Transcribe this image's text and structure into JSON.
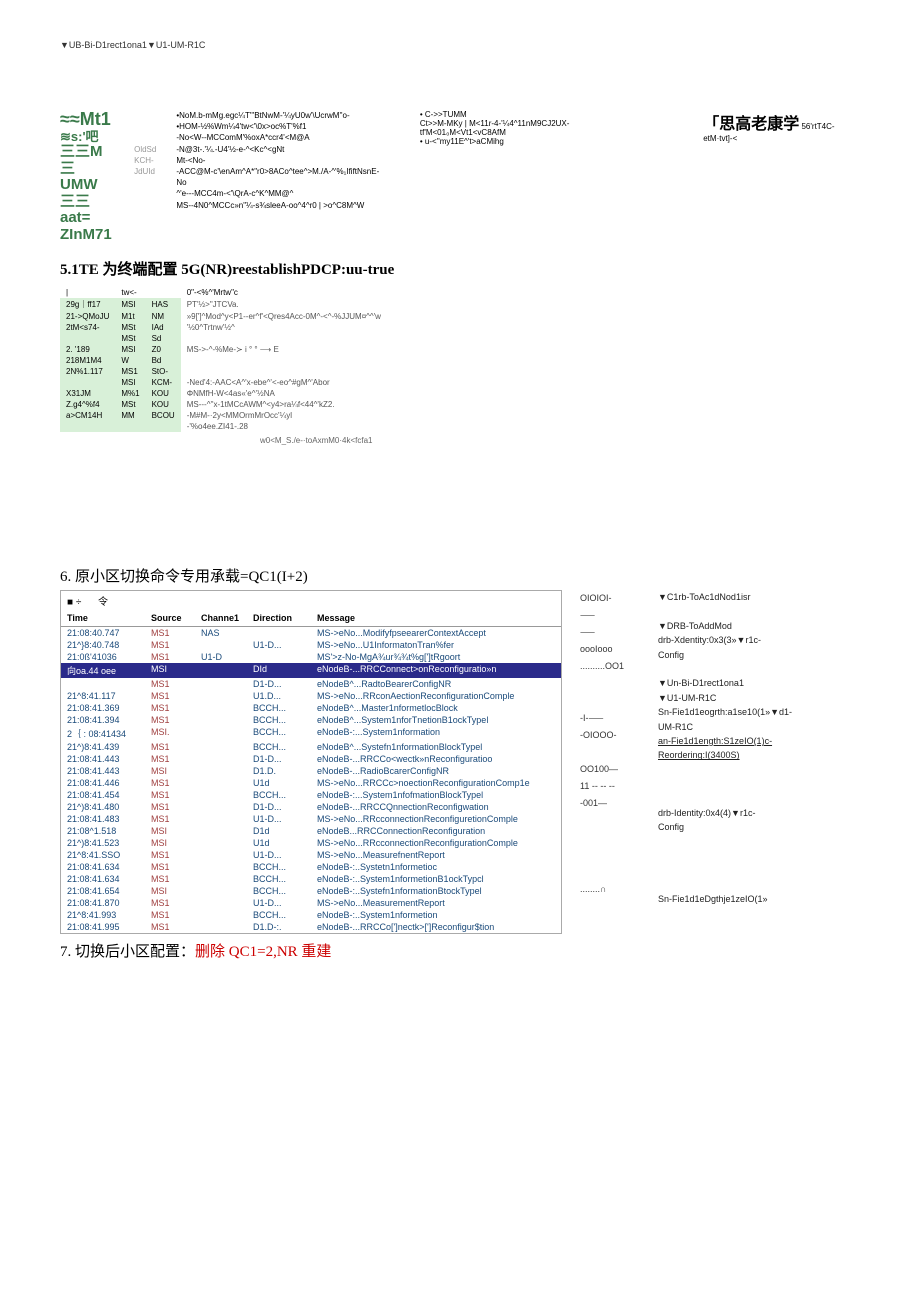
{
  "top_line": "▼UB-Bi-D1rect1ona1▼U1-UM-R1C",
  "blob1": {
    "l1": "≈≈Mt1",
    "l2": "≋s:'吧",
    "l3": "三三M",
    "l4": "三 UMW",
    "l5": "三三",
    "l6": "aat=",
    "l7": "ZInM71"
  },
  "midlabels": [
    "OldSd",
    "KCH-",
    "JdUId"
  ],
  "midlines": [
    "•NoM.b-mMg.egc¼T'\"BtNwM-'¼yU0w'\\UcrwM''o-",
    "•HOM-½%Wm¼4'tw<'\\0x>oc%T'%f1",
    "-No<W--MCComM'%oxA*ccr4'<M@A",
    "-N@3t-.'¼.-U4'½-e-^<Kc^<gNt",
    "Mt-<No-",
    "-ACC@M-c'\\enAm^A*\"r0>8ACo^tee^>M./A-^'%₁IfiftNsnE-No",
    "^'e---MCC4m-<'\\QrA-c^K^MM@^",
    "MS--4N0^MCCc»n\"¼-s¾sleeA-oo^4^r0  |  >o^C8M^W"
  ],
  "right1": [
    "• C->>TUMM",
    "Ct>>M-MKy  |  M<11r-4-'¼4^11nM9CJ2UX-tf'M<01₀M<Vt1<vC8AfM",
    "• u-<''my11E^'t>aCMihg"
  ],
  "cjk": "「思高老康学",
  "cjk_tail": "56'rtT4C-etM·tvt]-<",
  "h5": "5.1TE 为终端配置 5G(NR)reestablishPDCP:uu-true",
  "t5head": [
    "|",
    "tw<-",
    "0\"-<%^'Mrtw\"c"
  ],
  "t5": [
    [
      "29g｜ff17",
      "MSI",
      "HAS",
      "PT'½>\"JTCVa."
    ],
    [
      "21->QMoJU",
      "M1t",
      "NM",
      "»9[']^Mod^y<P1--er^f'<Qres4Acc-0M^-<^-%JJUM¤^^'w"
    ],
    [
      "2tM<s74-",
      "MSt",
      "IAd",
      "'½0^Trtnw'½^"
    ],
    [
      "",
      "MSt",
      "Sd",
      ""
    ],
    [
      "2.  '189",
      "MSI",
      "Z0",
      "MS->-^-%Me-≻    i   °      °   ⟶    E"
    ],
    [
      "218M1M4",
      "W",
      "Bd",
      ""
    ],
    [
      "2N%1.117",
      "MS1",
      "StO-",
      ""
    ],
    [
      "",
      "MSI",
      "KCM-",
      "-Ned'4:-AAC<A^'x-ebe^'<-eo^#gM^'Abor"
    ],
    [
      "X31JM",
      "M%1",
      "KOU",
      "ΦNMfH-W<4as«'e^'½NA"
    ],
    [
      "Z.g4^%f4",
      "MSt",
      "KOU",
      "MS---^''x-1tMCcAWM^<y4>ra¼f<44^'kZ2."
    ],
    [
      "a>CM14H",
      "MM",
      "BCOU",
      "-M#M-·2y<MMOrmMrOcc'¼yl"
    ],
    [
      "",
      "",
      "",
      "-'%o4ee.ZⅠ41-.28"
    ]
  ],
  "sub5": "w0<M_S./e-·toAxmM0·4k<fcfa1",
  "h6": "6. 原小区切换命令专用承载=QC1(I+2)",
  "t6cols": {
    "time": "Time",
    "src": "Source",
    "ch": "Channe1",
    "dir": "Direction",
    "msg": "Message"
  },
  "sq": "■ ÷",
  "sqr": "令",
  "t6": [
    [
      "21:08:40.747",
      "MS1",
      "NAS",
      "",
      "MS->eNo...ModifyfpseearerContextAccept",
      0
    ],
    [
      "21^}8:40.748",
      "MS1",
      "",
      "U1-D...",
      "MS->eNo...U1InformatonTran%fer",
      0
    ],
    [
      "21:0ß'41036",
      "MS1",
      "U1-D",
      "",
      "MS'>z-No-MgA¾ur¾¾t%g[']tRgoort",
      0
    ],
    [
      "向oa.44 oee",
      "MSI",
      "",
      "DId",
      "eNodeB-...RRCConnect>onReconfiguratio»n",
      1
    ],
    [
      "",
      "MS1",
      "",
      "D1-D...",
      "eNodeB^...RadtoBearerConfigNR",
      0
    ],
    [
      "21^8:41.117",
      "MS1",
      "",
      "U1.D...",
      "MS->eNo...RRconAectionReconfigurationComple",
      0
    ],
    [
      "21:08:41.369",
      "MS1",
      "",
      "BCCH...",
      "eNodeB^...Master1nformetlocBlock",
      0
    ],
    [
      "21:08:41.394",
      "MS1",
      "",
      "BCCH...",
      "eNodeB^...System1nforTnetionB1ockTypel",
      0
    ],
    [
      "2｛ :  08:41434",
      "MSI.",
      "",
      "BCCH...",
      "eNodeB-:...System1nformation",
      0
    ],
    [
      "21^)8:41.439",
      "MS1",
      "",
      "BCCH...",
      "eNodeB^...Systefn1nformationBlockTypel",
      0
    ],
    [
      "21:08:41.443",
      "MS1",
      "",
      "D1-D...",
      "eNodeB-...RRCCo<wectk»nReconfiguratioo",
      0
    ],
    [
      "21:08:41.443",
      "MSI",
      "",
      "D1.D.",
      "eNodeB-...RadioBcarerConfigNR",
      0
    ],
    [
      "21:08:41.446",
      "MS1",
      "",
      "U1d",
      "MS->eNo...RRCCc>noectionReconfigurationComp1e",
      0
    ],
    [
      "21:08:41.454",
      "MS1",
      "",
      "BCCH...",
      "eNodeB-:...System1nfofmationBlockTypel",
      0
    ],
    [
      "21^)8:41.480",
      "MS1",
      "",
      "D1-D...",
      "eNodeB-...RRCCQnnectionReconfigwation",
      0
    ],
    [
      "21:08:41.483",
      "MS1",
      "",
      "U1-D...",
      "MS->eNo...RRcconnectionReconfiguretionComple",
      0
    ],
    [
      "21:08^1.518",
      "MSI",
      "",
      "D1d",
      "eNodeB...RRCConnectionReconfiguration",
      0
    ],
    [
      "21^)8:41.523",
      "MSI",
      "",
      "U1d",
      "MS->eNo...RRcconnectionReconfigurationComple",
      0
    ],
    [
      "21^8:41.SSO",
      "MS1",
      "",
      "U1-D...",
      "MS->eNo...MeasurefnentReport",
      0
    ],
    [
      "21:08:41.634",
      "MS1",
      "",
      "BCCH...",
      "eNodeB-:..Systetn1nformetioc",
      0
    ],
    [
      "21:08:41.634",
      "MS1",
      "",
      "BCCH...",
      "eNodeB-:..System1nformetionB1ockTypcl",
      0
    ],
    [
      "21:08:41.654",
      "MSI",
      "",
      "BCCH...",
      "eNodeB-:..Systefn1nformationBtockTypel",
      0
    ],
    [
      "21:08:41.870",
      "MS1",
      "",
      "U1-D...",
      "MS->eNo...MeasurementReport",
      0
    ],
    [
      "21^8:41.993",
      "MS1",
      "",
      "BCCH...",
      "eNodeB-:..System1nformetion",
      0
    ],
    [
      "21:08:41.995",
      "MS1",
      "",
      "D1.D-:.",
      "eNodeB-...RRCCo[']nectk>[']Reconfigur$tion",
      0
    ]
  ],
  "mid6": [
    "OIOIOI-",
    "⸺",
    "⸺",
    "oooIooo",
    "..........OO1",
    "",
    "",
    "-I-⸺",
    "-OIOOO-",
    "",
    "OO100—",
    "11  -- -- --",
    "-001—",
    "",
    "",
    "",
    "",
    "........∩"
  ],
  "r6": [
    "▼C1rb-ToAc1dNod1isr",
    "",
    "▼DRB-ToAddMod",
    "drb-Xdentity:0x3(3»▼r1c-",
    "Config",
    "",
    "▼Un-Bi-D1rect1ona1",
    "▼U1-UM-R1C",
    "Sn-Fie1d1eogrth:a1se10(1»▼d1-",
    "UM-R1C",
    "an-Fie1d1ength:S1zeIO(1)c-",
    "Reordering:I(3400S)",
    "",
    "",
    "",
    "drb-Identity:0x4(4)▼r1c-",
    "Config",
    "",
    "",
    "",
    "",
    "Sn-Fie1d1eDgthje1zeIO(1»"
  ],
  "h7": {
    "a": "7. 切换后小区配置：",
    "b": "删除 QC1=2,NR 重建"
  }
}
